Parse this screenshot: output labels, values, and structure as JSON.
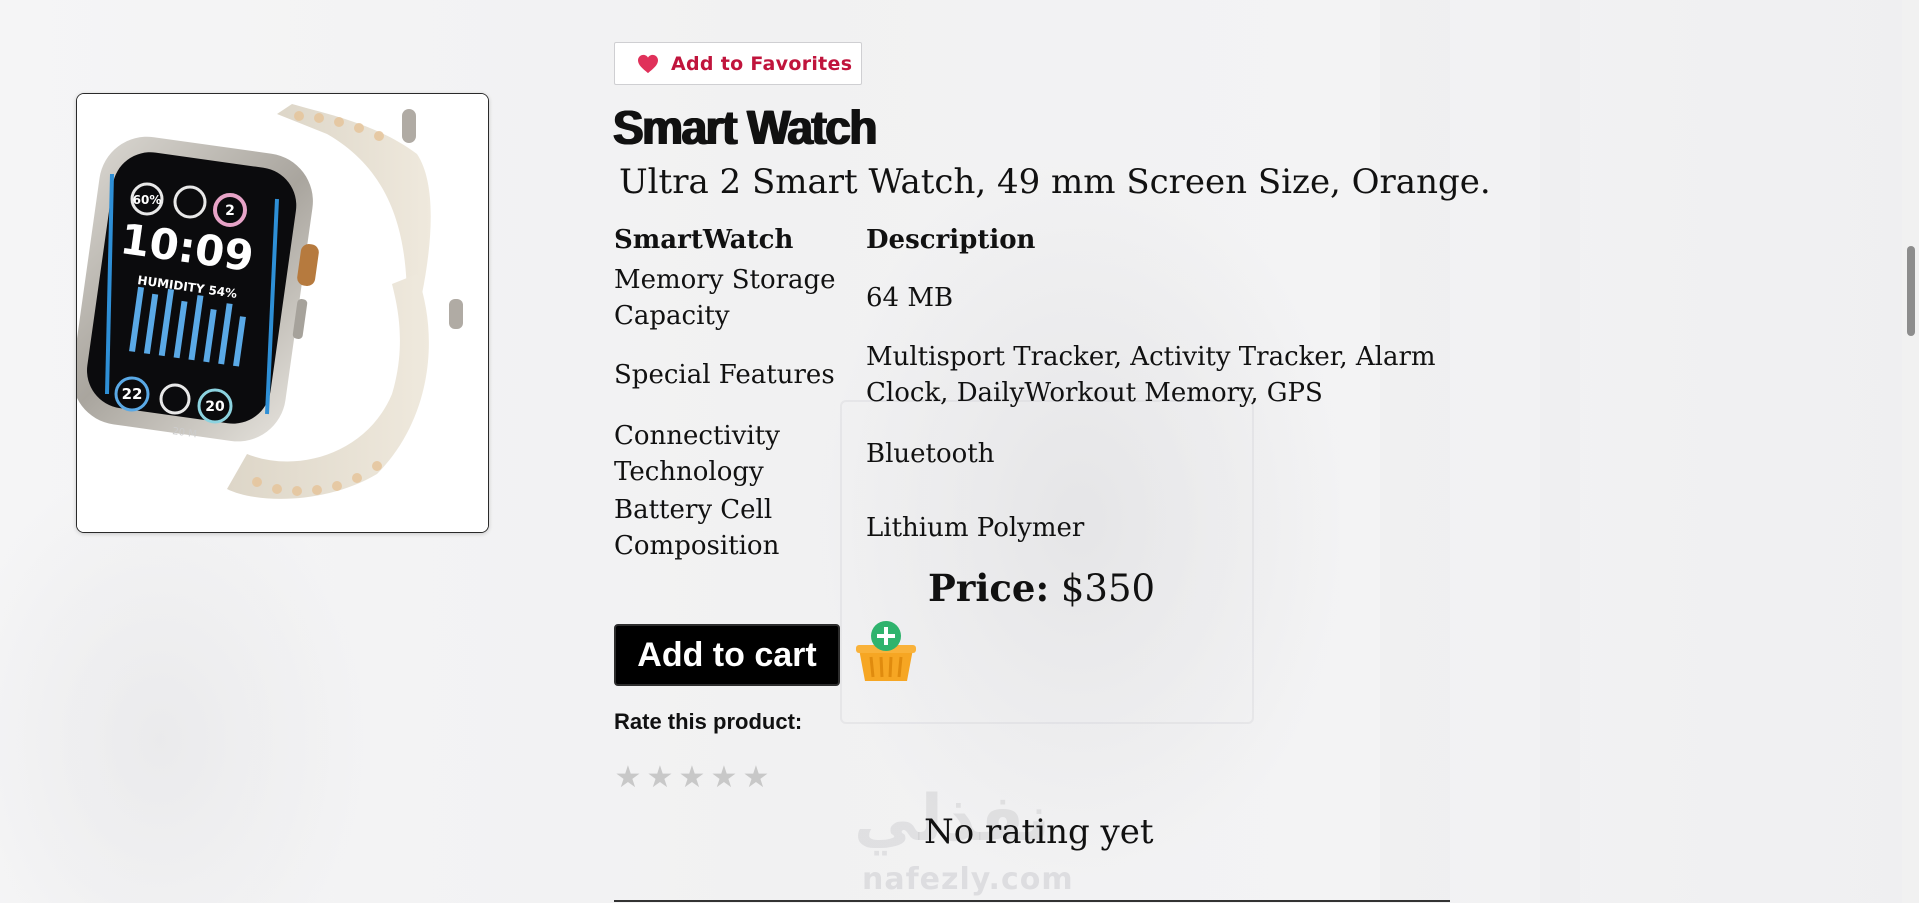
{
  "favorites": {
    "label": "Add to Favorites",
    "icon": "heart-icon",
    "color": "#c0143c"
  },
  "product": {
    "name": "Smart Watch",
    "subtitle": "Ultra 2 Smart Watch, 49 mm Screen Size, Orange.",
    "image_alt": "smart-watch-image"
  },
  "specs": {
    "header": {
      "key": "SmartWatch",
      "value": "Description"
    },
    "rows": [
      {
        "key": "Memory Storage Capacity",
        "value": "64 MB"
      },
      {
        "key": "Special Features",
        "value": "Multisport Tracker, Activity Tracker, Alarm Clock, DailyWorkout Memory, GPS"
      },
      {
        "key": "Connectivity Technology",
        "value": "Bluetooth"
      },
      {
        "key": "Battery Cell Composition",
        "value": "Lithium Polymer"
      }
    ]
  },
  "price": {
    "label": "Price:",
    "value": "$350"
  },
  "cart": {
    "button_label": "Add to cart",
    "icon": "add-basket-icon"
  },
  "rating": {
    "label": "Rate this product:",
    "stars": [
      "★",
      "★",
      "★",
      "★",
      "★"
    ],
    "status": "No rating yet"
  },
  "watermark": {
    "arabic": "نفذلي",
    "latin": "nafezly.com"
  },
  "watch_face": {
    "time": "10:09",
    "humidity": "HUMIDITY 54%",
    "ring1": "60%",
    "ring2": "2",
    "c1": "22",
    "c2": "20",
    "bottom": "20 M"
  }
}
